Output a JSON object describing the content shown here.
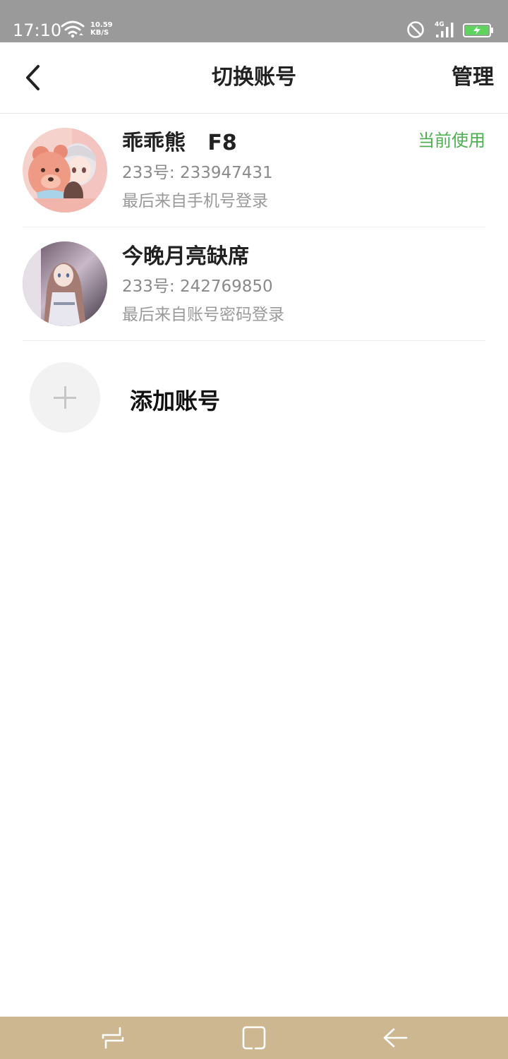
{
  "status_bar": {
    "time": "17:10",
    "speed_value": "10.59",
    "speed_unit": "KB/S",
    "network_type": "4G",
    "icons": [
      "wifi-icon",
      "do-not-disturb-icon",
      "signal-icon",
      "battery-charging-icon"
    ],
    "battery_color": "#5ed35e"
  },
  "header": {
    "back_icon": "chevron-left-icon",
    "title": "切换账号",
    "manage_label": "管理"
  },
  "accounts": [
    {
      "name": "乖乖熊   F8",
      "id_text": "233号: 233947431",
      "login_text": "最后来自手机号登录",
      "badge": "当前使用"
    },
    {
      "name": "今晚月亮缺席",
      "id_text": "233号: 242769850",
      "login_text": "最后来自账号密码登录"
    }
  ],
  "add_account": {
    "icon": "plus-icon",
    "label": "添加账号"
  },
  "nav_bar": {
    "icons": [
      "recent-apps-icon",
      "home-icon",
      "back-arrow-icon"
    ],
    "color": "#cdb791"
  },
  "colors": {
    "accent_green": "#4caf50",
    "status_bar_bg": "#9a9a9a"
  }
}
